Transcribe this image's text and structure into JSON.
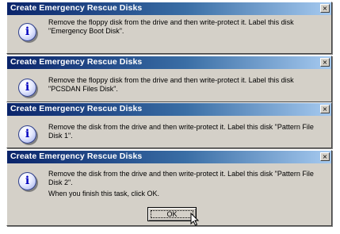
{
  "dialogs": [
    {
      "title": "Create Emergency Rescue Disks",
      "message": "Remove the floppy disk from the drive and then write-protect it. Label this disk \"Emergency Boot Disk\".",
      "close": "×"
    },
    {
      "title": "Create Emergency Rescue Disks",
      "message": "Remove the floppy disk from the drive and then write-protect it. Label this disk \"PCSDAN Files Disk\".",
      "close": "×"
    },
    {
      "title": "Create Emergency Rescue Disks",
      "message": "Remove the disk from the drive and then write-protect it. Label this disk \"Pattern File Disk 1\".",
      "close": "×"
    },
    {
      "title": "Create Emergency Rescue Disks",
      "message": "Remove the disk from the drive and then write-protect it. Label this disk \"Pattern File Disk 2\".",
      "message2": "When you finish this task, click OK.",
      "close": "×",
      "ok_label": "OK"
    }
  ],
  "icons": {
    "info": "i"
  },
  "colors": {
    "titlebar_start": "#0a246a",
    "titlebar_end": "#a6caf0",
    "dialog_face": "#d4d0c8",
    "info_glyph": "#0000c0"
  }
}
